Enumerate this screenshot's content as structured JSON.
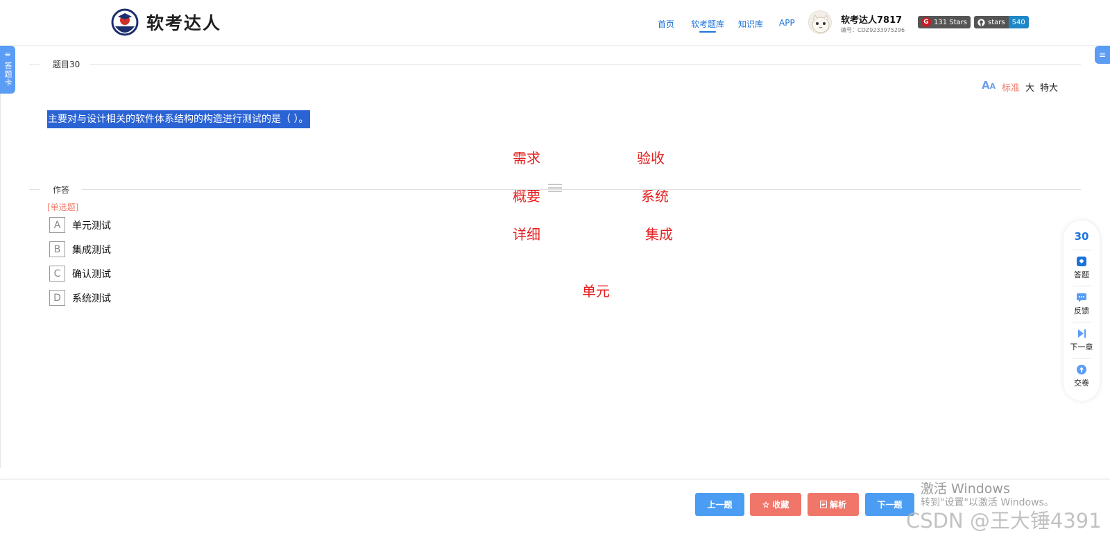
{
  "header": {
    "logo_text": "软考达人",
    "nav": [
      "首页",
      "软考题库",
      "知识库",
      "APP"
    ],
    "active_nav_index": 1,
    "user": {
      "name": "软考达人7817",
      "id": "编号：CDZ9233975296"
    },
    "badges": {
      "gitee_stars": "131 Stars",
      "github_label": "stars",
      "github_count": "540"
    }
  },
  "side": {
    "answer_card_label": "答题卡"
  },
  "question_section": {
    "title": "题目30",
    "font_sizes": [
      "标准",
      "大",
      "特大"
    ],
    "active_font_size": "标准",
    "stem": "主要对与设计相关的软件体系结构的构造进行测试的是（ ）。"
  },
  "annotations": [
    "需求",
    "验收",
    "概要",
    "系统",
    "详细",
    "集成",
    "单元"
  ],
  "answer_section": {
    "title": "作答",
    "type": "[单选题]",
    "options": [
      {
        "key": "A",
        "text": "单元测试"
      },
      {
        "key": "B",
        "text": "集成测试"
      },
      {
        "key": "C",
        "text": "确认测试"
      },
      {
        "key": "D",
        "text": "系统测试"
      }
    ]
  },
  "float_bar": {
    "number": "30",
    "items": [
      "答题",
      "反馈",
      "下一章",
      "交卷"
    ]
  },
  "bottom": {
    "prev": "上一题",
    "favorite": "收藏",
    "analysis": "解析",
    "next": "下一题"
  },
  "watermarks": {
    "windows_line1": "激活 Windows",
    "windows_line2": "转到\"设置\"以激活 Windows。",
    "csdn": "CSDN @王大锤4391"
  },
  "colors": {
    "primary": "#1a73d9",
    "button_blue": "#4a9df2",
    "button_red": "#f0766a",
    "highlight": "#2a63d4",
    "annotation_red": "#e62020"
  }
}
